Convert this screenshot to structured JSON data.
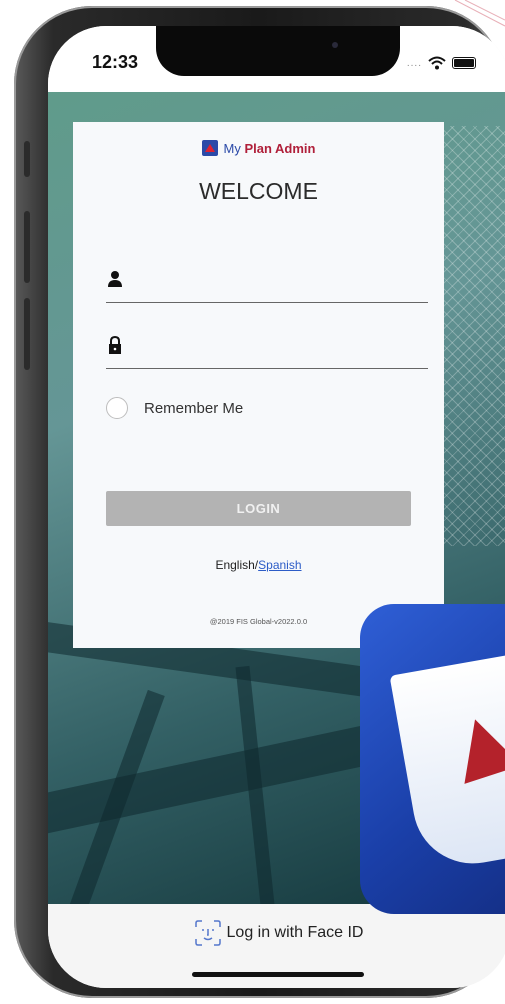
{
  "status_bar": {
    "time": "12:33",
    "signal_dots": "...."
  },
  "card": {
    "brand_my": "My ",
    "brand_plan": "Plan Admin",
    "welcome": "WELCOME",
    "username_placeholder": "",
    "password_placeholder": "",
    "remember_me": "Remember Me",
    "login_button": "LOGIN",
    "lang_english": "English/",
    "lang_spanish": "Spanish",
    "copyright": "@2019 FIS Global-v2022.0.0"
  },
  "bottom": {
    "faceid_label": "Log in with Face ID"
  },
  "colors": {
    "brand_blue": "#2b4aa8",
    "brand_red": "#b0203a",
    "button_disabled": "#b3b3b3",
    "link": "#2c5cc7"
  },
  "icons": [
    "user-icon",
    "lock-icon",
    "face-id-icon",
    "wifi-icon",
    "battery-icon",
    "app-icon"
  ]
}
